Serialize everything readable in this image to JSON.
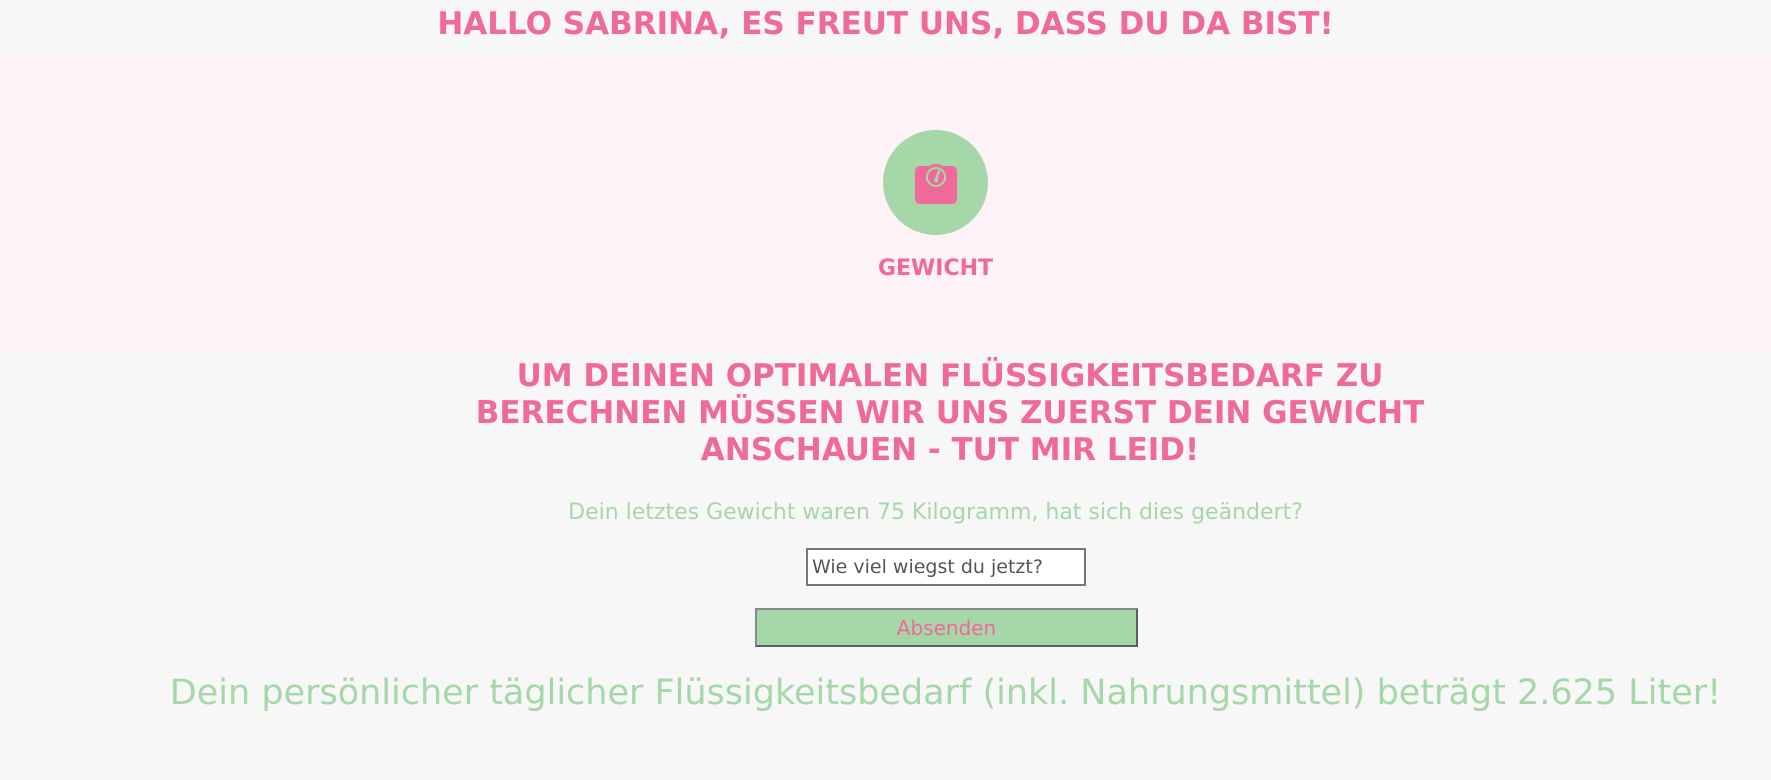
{
  "header": {
    "greeting": "HALLO SABRINA, ES FREUT UNS, DASS DU DA BIST!"
  },
  "hero": {
    "icon": "scale-icon",
    "label": "GEWICHT"
  },
  "main": {
    "heading": "UM DEINEN OPTIMALEN FLÜSSIGKEITSBEDARF ZU BERECHNEN MÜSSEN WIR UNS ZUERST DEIN GEWICHT ANSCHAUEN - TUT MIR LEID!",
    "info": "Dein letztes Gewicht waren 75 Kilogramm, hat sich dies geändert?",
    "weight_input": {
      "value": "",
      "placeholder": "Wie viel wiegst du jetzt?"
    },
    "submit_label": "Absenden",
    "result": "Dein persönlicher täglicher Flüssigkeitsbedarf (inkl. Nahrungsmittel) beträgt 2.625 Liter!"
  },
  "colors": {
    "accent_pink": "#ef6a98",
    "accent_green": "#a6d7a8",
    "hero_background": "#fdf2f5",
    "page_background": "#f7f7f7"
  }
}
